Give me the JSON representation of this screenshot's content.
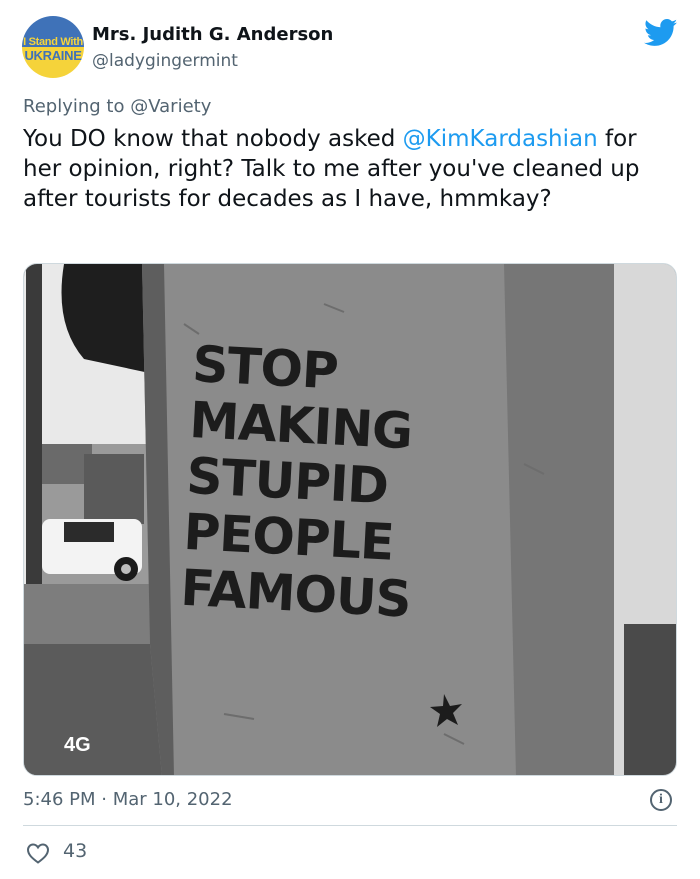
{
  "author": {
    "avatar_line1": "I Stand With",
    "avatar_line2": "UKRAINE",
    "display_name": "Mrs. Judith G. Anderson",
    "handle": "@ladygingermint"
  },
  "reply": {
    "prefix": "Replying to",
    "mention": "@Variety"
  },
  "tweet": {
    "text_before": "You DO know that nobody asked ",
    "mention": "@KimKardashian",
    "text_after": " for her opinion, right?  Talk to me after you've cleaned up after tourists for decades as I have, hmmkay?"
  },
  "media": {
    "graffiti_lines": [
      "STOP",
      "MAKING",
      "STUPID",
      "PEOPLE",
      "FAMOUS"
    ],
    "store_sign": "4G"
  },
  "meta": {
    "timestamp": "5:46 PM · Mar 10, 2022",
    "info_glyph": "i"
  },
  "engagement": {
    "likes": "43"
  },
  "colors": {
    "link": "#1d9bf0",
    "secondary_text": "#536471",
    "twitter_blue": "#1d9bf0"
  },
  "icons": [
    "twitter-bird-icon",
    "info-icon",
    "heart-icon"
  ]
}
